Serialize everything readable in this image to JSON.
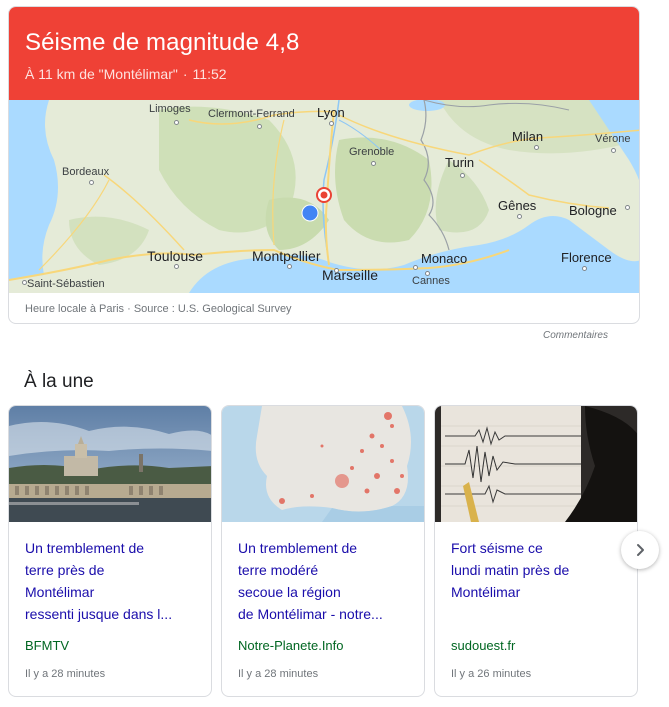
{
  "quake": {
    "title": "Séisme de magnitude 4,8",
    "location": "À 11 km de \"Montélimar\"",
    "separator": "·",
    "time": "11:52",
    "footer": "Heure locale à Paris · Source : U.S. Geological Survey",
    "header_color": "#ef4136"
  },
  "map": {
    "cities": {
      "limoges": "Limoges",
      "clermont": "Clermont-Ferrand",
      "lyon": "Lyon",
      "milan": "Milan",
      "verone": "Vérone",
      "bordeaux": "Bordeaux",
      "grenoble": "Grenoble",
      "turin": "Turin",
      "genes": "Gênes",
      "bologne": "Bologne",
      "toulouse": "Toulouse",
      "montpellier": "Montpellier",
      "monaco": "Monaco",
      "florence": "Florence",
      "marseille": "Marseille",
      "cannes": "Cannes",
      "saint_sebastien": "Saint-Sébastien"
    },
    "epicenter_icon": "target-icon",
    "user_location_icon": "blue-dot-icon"
  },
  "feedback_label": "Commentaires",
  "section_title": "À la une",
  "news": [
    {
      "title_lines": [
        "Un tremblement de",
        "terre près de",
        "Montélimar",
        "ressenti jusque dans l..."
      ],
      "source": "BFMTV",
      "time": "Il y a 28 minutes"
    },
    {
      "title_lines": [
        "Un tremblement de",
        "terre modéré",
        "secoue la région",
        "de Montélimar - notre..."
      ],
      "source": "Notre-Planete.Info",
      "time": "Il y a 28 minutes"
    },
    {
      "title_lines": [
        "Fort séisme ce",
        "lundi matin près de",
        "Montélimar"
      ],
      "source": "sudouest.fr",
      "time": "Il y a 26 minutes"
    }
  ],
  "next_button_icon": "chevron-right-icon",
  "colors": {
    "link": "#1a0dab",
    "source": "#006621",
    "sea": "#aadaff",
    "user_dot": "#4285f4"
  }
}
